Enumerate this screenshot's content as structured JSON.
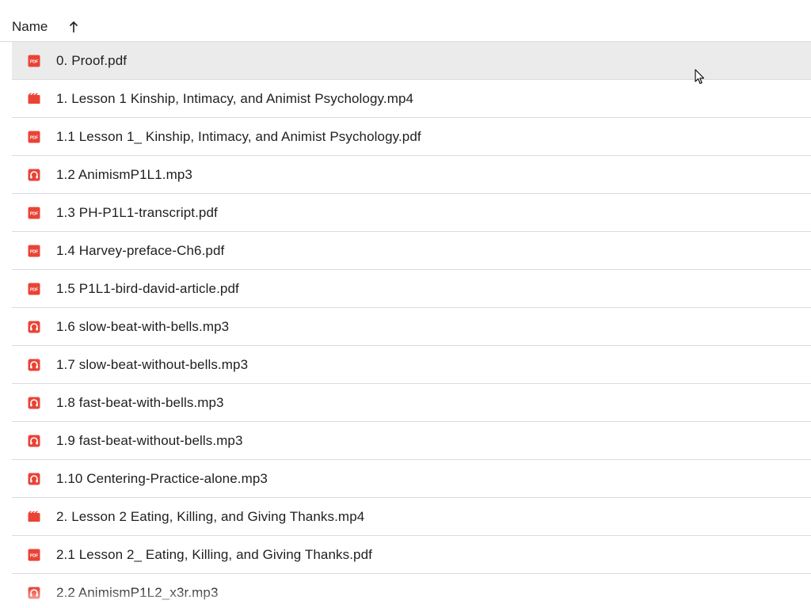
{
  "header": {
    "name_label": "Name",
    "sort_icon": "arrow-up-icon"
  },
  "colors": {
    "pdf_icon": "#ea4335",
    "video_icon": "#ea4335",
    "audio_icon": "#ea4335",
    "selected_row": "#ebebeb",
    "divider": "#dadce0"
  },
  "files": [
    {
      "name": "0. Proof.pdf",
      "type": "pdf",
      "icon": "pdf-icon",
      "selected": true
    },
    {
      "name": "1. Lesson 1 Kinship, Intimacy, and Animist Psychology.mp4",
      "type": "video",
      "icon": "video-icon"
    },
    {
      "name": "1.1 Lesson 1_ Kinship, Intimacy, and Animist Psychology.pdf",
      "type": "pdf",
      "icon": "pdf-icon"
    },
    {
      "name": "1.2 AnimismP1L1.mp3",
      "type": "audio",
      "icon": "audio-icon"
    },
    {
      "name": "1.3 PH-P1L1-transcript.pdf",
      "type": "pdf",
      "icon": "pdf-icon"
    },
    {
      "name": "1.4 Harvey-preface-Ch6.pdf",
      "type": "pdf",
      "icon": "pdf-icon"
    },
    {
      "name": "1.5 P1L1-bird-david-article.pdf",
      "type": "pdf",
      "icon": "pdf-icon"
    },
    {
      "name": "1.6 slow-beat-with-bells.mp3",
      "type": "audio",
      "icon": "audio-icon"
    },
    {
      "name": "1.7 slow-beat-without-bells.mp3",
      "type": "audio",
      "icon": "audio-icon"
    },
    {
      "name": "1.8 fast-beat-with-bells.mp3",
      "type": "audio",
      "icon": "audio-icon"
    },
    {
      "name": "1.9 fast-beat-without-bells.mp3",
      "type": "audio",
      "icon": "audio-icon"
    },
    {
      "name": "1.10 Centering-Practice-alone.mp3",
      "type": "audio",
      "icon": "audio-icon"
    },
    {
      "name": "2. Lesson 2 Eating, Killing, and Giving Thanks.mp4",
      "type": "video",
      "icon": "video-icon"
    },
    {
      "name": "2.1 Lesson 2_ Eating, Killing, and Giving Thanks.pdf",
      "type": "pdf",
      "icon": "pdf-icon"
    },
    {
      "name": "2.2 AnimismP1L2_x3r.mp3",
      "type": "audio",
      "icon": "audio-icon"
    }
  ]
}
